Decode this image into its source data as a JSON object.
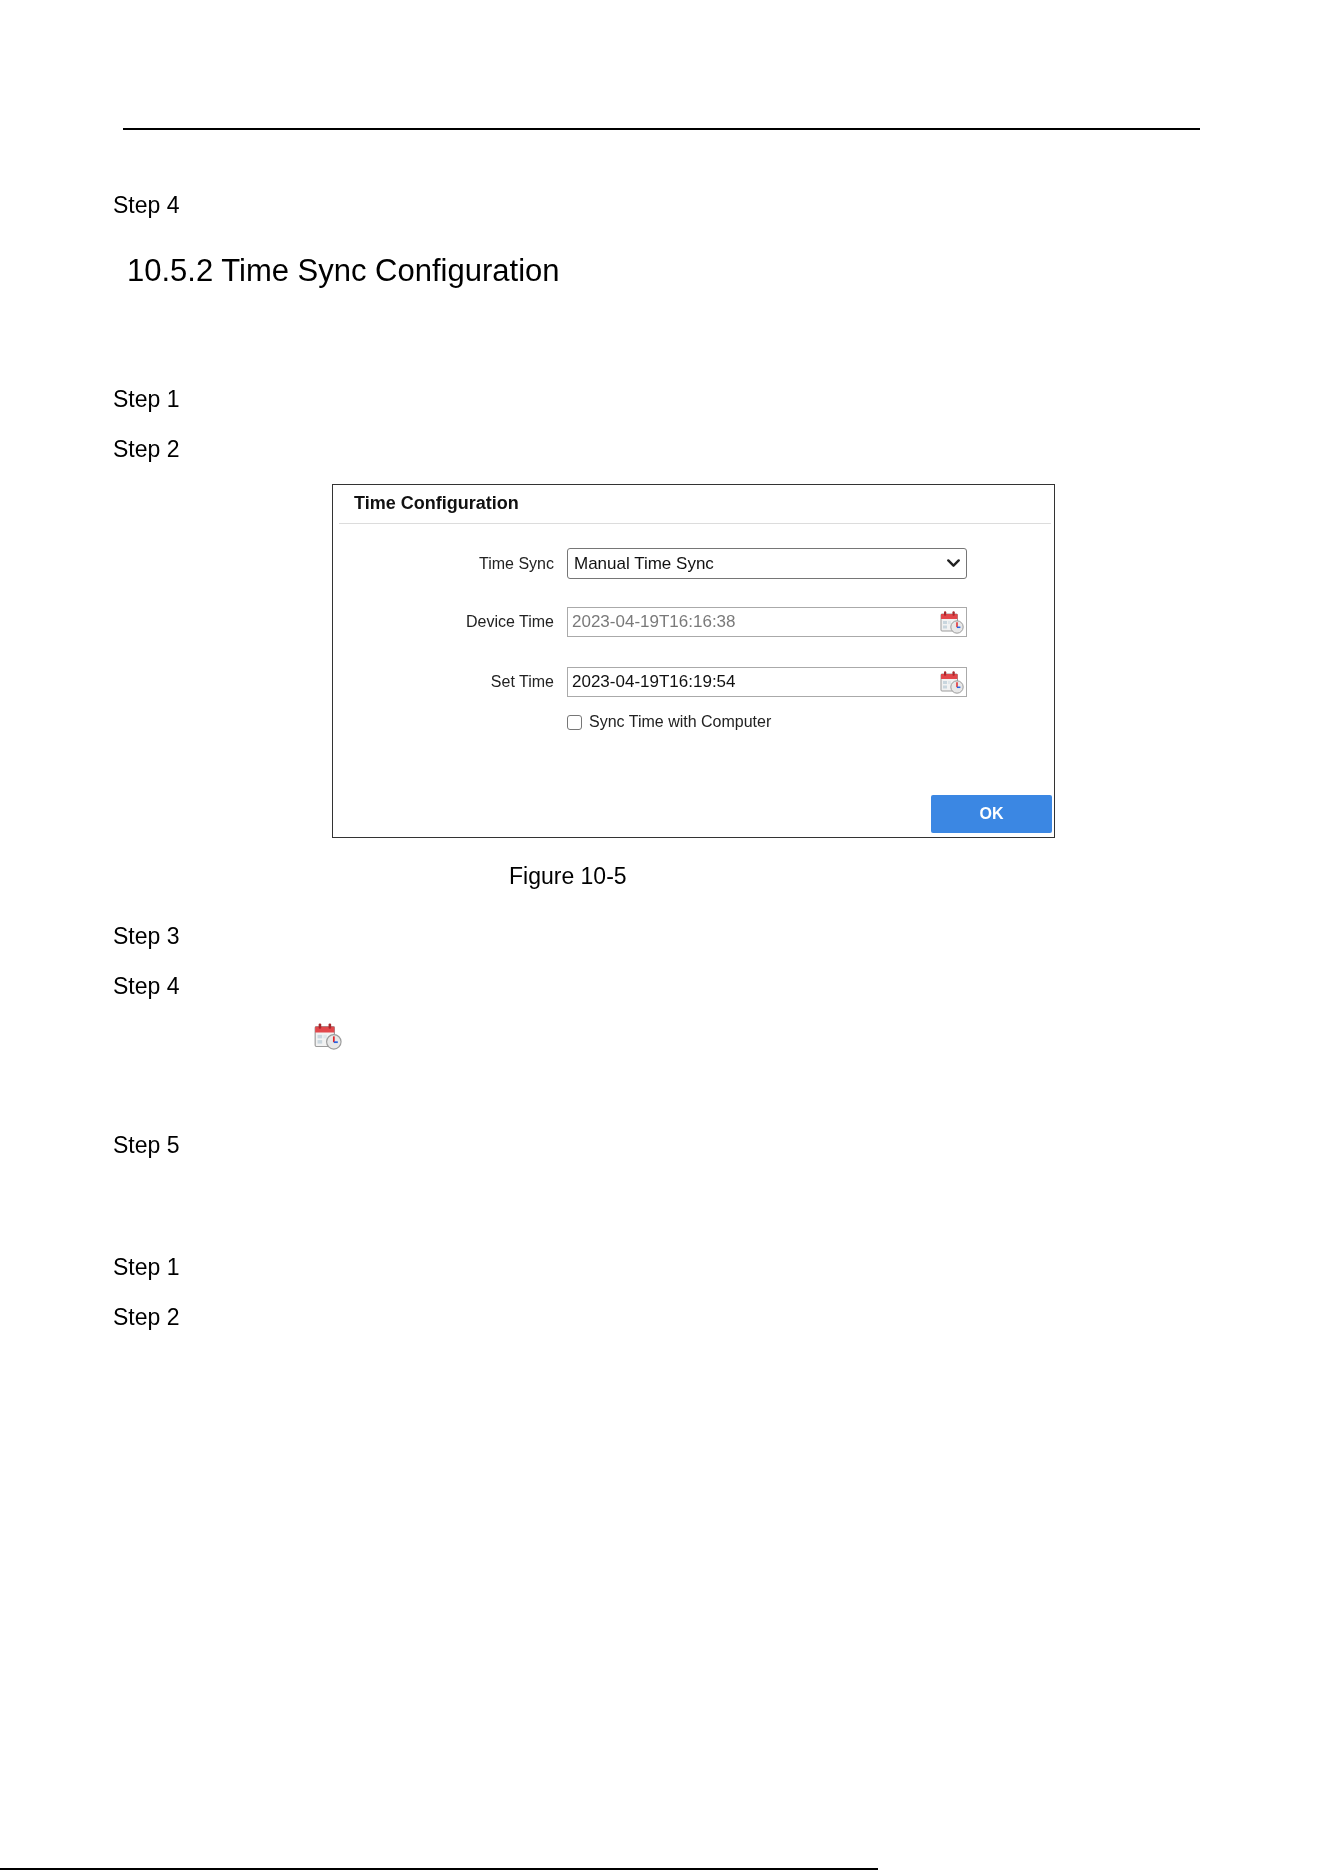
{
  "intro": {
    "steps": [
      {
        "label": "Step 4"
      }
    ]
  },
  "section": {
    "heading": "10.5.2 Time Sync Configuration",
    "steps_before_figure": [
      {
        "label": "Step 1"
      },
      {
        "label": "Step 2"
      }
    ],
    "figure": {
      "panel": {
        "title": "Time Configuration",
        "fields": [
          {
            "kind": "select",
            "label": "Time Sync",
            "value": "Manual Time Sync"
          },
          {
            "kind": "datetime",
            "label": "Device Time",
            "value": "2023-04-19T16:16:38",
            "disabled": true
          },
          {
            "kind": "datetime",
            "label": "Set Time",
            "value": "2023-04-19T16:19:54",
            "disabled": false
          },
          {
            "kind": "checkbox",
            "label": "Sync Time with Computer",
            "checked": false
          }
        ],
        "buttons": [
          {
            "label": "OK"
          }
        ]
      },
      "caption": "Figure 10-5"
    },
    "steps_after_figure": [
      {
        "label": "Step 3",
        "shows_icon": false
      },
      {
        "label": "Step 4",
        "shows_icon": true
      },
      {
        "label": "Step 5",
        "shows_icon": false
      }
    ]
  },
  "next_procedure": {
    "steps": [
      {
        "label": "Step 1"
      },
      {
        "label": "Step 2"
      }
    ]
  }
}
